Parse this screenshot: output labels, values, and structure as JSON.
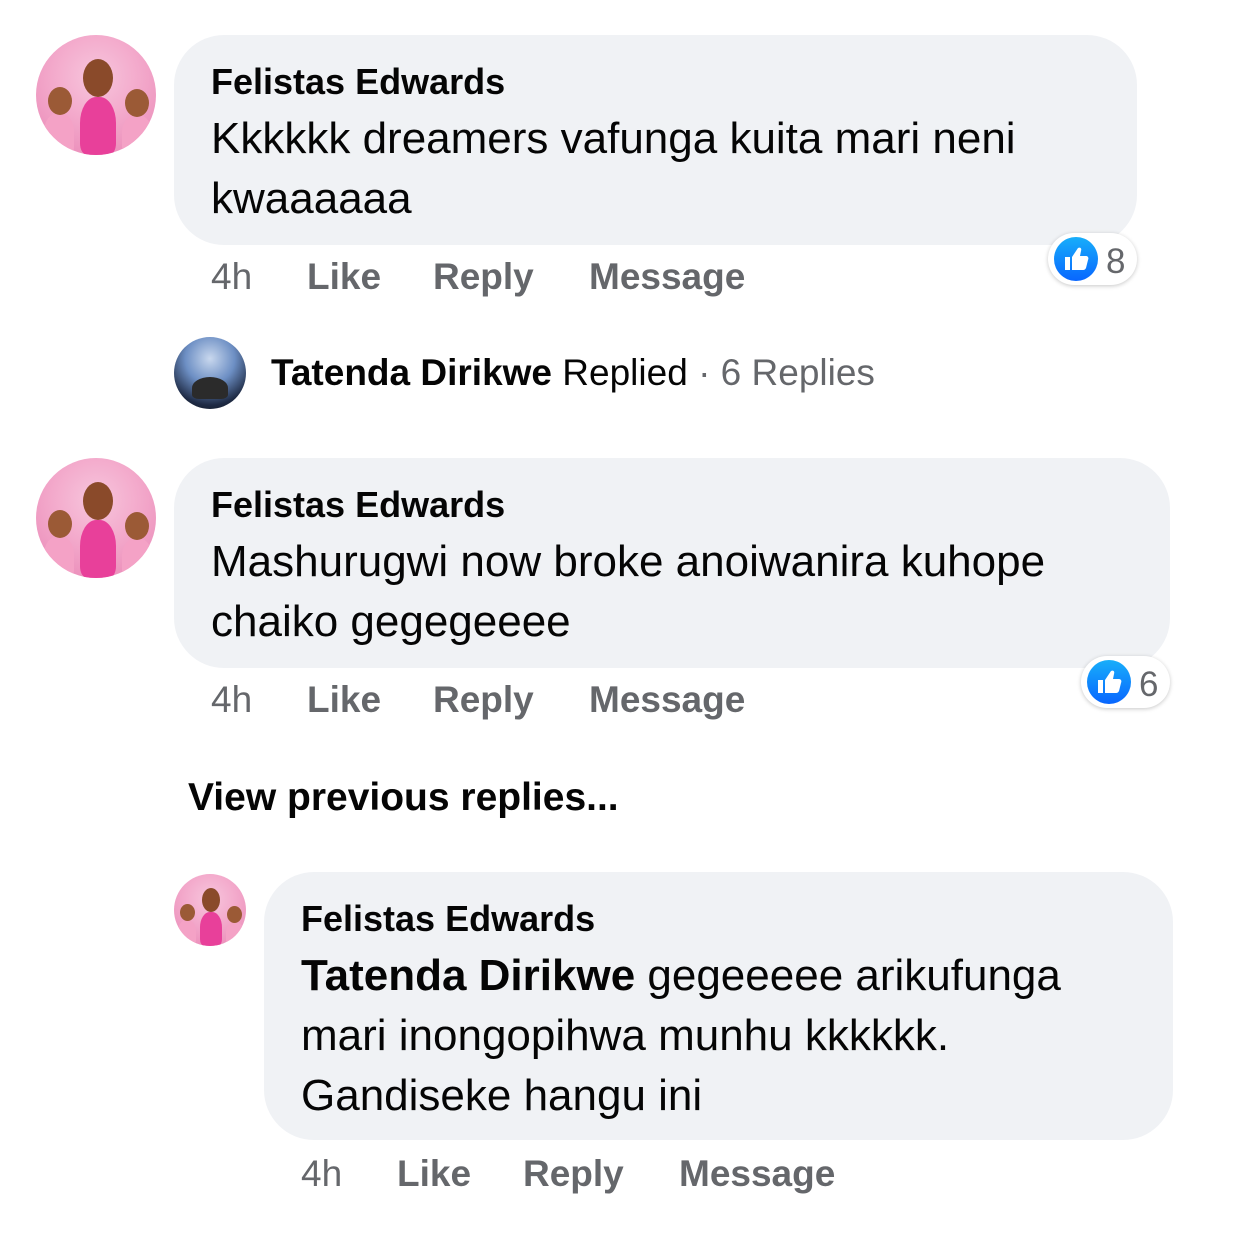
{
  "comments": [
    {
      "author": "Felistas Edwards",
      "text_lines": [
        "Kkkkkk dreamers vafunga kuita mari neni",
        "kwaaaaaa"
      ],
      "time": "4h",
      "like_label": "Like",
      "reply_label": "Reply",
      "message_label": "Message",
      "reaction_count": "8",
      "reaction_icon": "like-icon"
    },
    {
      "author": "Felistas Edwards",
      "text_lines": [
        "Mashurugwi now broke anoiwanira kuhope",
        "chaiko gegegeeee"
      ],
      "time": "4h",
      "like_label": "Like",
      "reply_label": "Reply",
      "message_label": "Message",
      "reaction_count": "6",
      "reaction_icon": "like-icon"
    }
  ],
  "reply_summary": {
    "name": "Tatenda Dirikwe",
    "replied_word": "Replied",
    "separator": "·",
    "count_label": "6 Replies"
  },
  "view_previous_label": "View previous replies...",
  "reply": {
    "author": "Felistas Edwards",
    "mention": "Tatenda Dirikwe",
    "line1_rest": " gegeeeee arikufunga",
    "line2": "mari inongopihwa munhu kkkkkk.",
    "line3": "Gandiseke hangu ini",
    "time": "4h",
    "like_label": "Like",
    "reply_label": "Reply",
    "message_label": "Message"
  },
  "colors": {
    "bubble": "#f0f2f5",
    "secondary_text": "#65676b",
    "like_blue": "#0866ff"
  }
}
